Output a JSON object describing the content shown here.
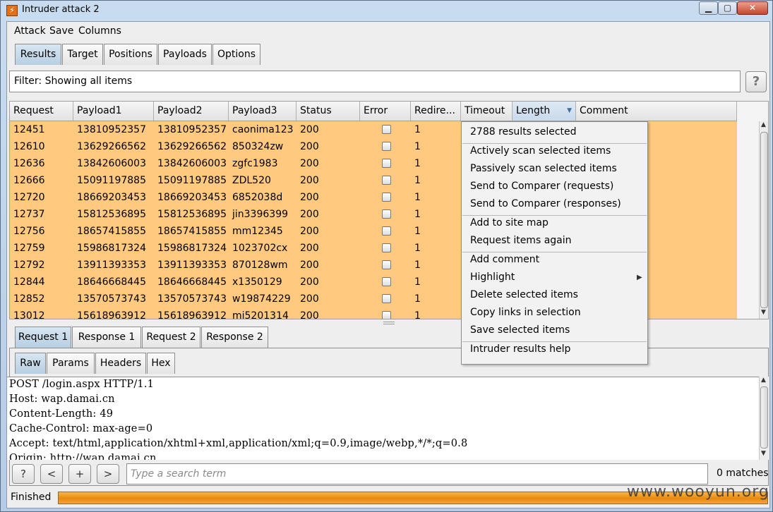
{
  "window": {
    "title": "Intruder attack 2",
    "app_icon": "burp-flame-icon",
    "controls": [
      "minimize-icon",
      "maximize-icon",
      "close-icon"
    ]
  },
  "menubar": [
    "Attack",
    "Save",
    "Columns"
  ],
  "main_tabs": [
    "Results",
    "Target",
    "Positions",
    "Payloads",
    "Options"
  ],
  "filter": {
    "text": "Filter: Showing all items",
    "help": "?"
  },
  "results": {
    "columns": [
      "Request",
      "Payload1",
      "Payload2",
      "Payload3",
      "Status",
      "Error",
      "Redire...",
      "Timeout",
      "Length",
      "Comment"
    ],
    "sorted_column": "Length",
    "rows": [
      [
        "12451",
        "13810952357",
        "13810952357",
        "caonima123",
        "200",
        "",
        "1"
      ],
      [
        "12610",
        "13629266562",
        "13629266562",
        "850324zw",
        "200",
        "",
        "1"
      ],
      [
        "12636",
        "13842606003",
        "13842606003",
        "zgfc1983",
        "200",
        "",
        "1"
      ],
      [
        "12666",
        "15091197885",
        "15091197885",
        "ZDL520",
        "200",
        "",
        "1"
      ],
      [
        "12720",
        "18669203453",
        "18669203453",
        "6852038d",
        "200",
        "",
        "1"
      ],
      [
        "12737",
        "15812536895",
        "15812536895",
        "jin3396399",
        "200",
        "",
        "1"
      ],
      [
        "12756",
        "18657415855",
        "18657415855",
        "mm12345",
        "200",
        "",
        "1"
      ],
      [
        "12759",
        "15986817324",
        "15986817324",
        "1023702cx",
        "200",
        "",
        "1"
      ],
      [
        "12792",
        "13911393353",
        "13911393353",
        "870128wm",
        "200",
        "",
        "1"
      ],
      [
        "12844",
        "18646668445",
        "18646668445",
        "x1350129",
        "200",
        "",
        "1"
      ],
      [
        "12852",
        "13570573743",
        "13570573743",
        "w19874229",
        "200",
        "",
        "1"
      ],
      [
        "13012",
        "15618963912",
        "15618963912",
        "mi5201314",
        "200",
        "",
        "1"
      ]
    ],
    "row_color": "#ffc97f"
  },
  "context_menu": {
    "header": "2788 results selected",
    "group1": [
      "Actively scan selected items",
      "Passively scan selected items",
      "Send to Comparer (requests)",
      "Send to Comparer (responses)"
    ],
    "group2": [
      "Add to site map",
      "Request items again"
    ],
    "group3": [
      "Add comment",
      "Highlight",
      "Delete selected items",
      "Copy links in selection",
      "Save selected items"
    ],
    "group4": [
      "Intruder results help"
    ]
  },
  "detail_tabs": [
    "Request 1",
    "Response 1",
    "Request 2",
    "Response 2"
  ],
  "view_tabs": [
    "Raw",
    "Params",
    "Headers",
    "Hex"
  ],
  "raw_request": [
    "POST /login.aspx HTTP/1.1",
    "Host: wap.damai.cn",
    "Content-Length: 49",
    "Cache-Control: max-age=0",
    "Accept: text/html,application/xhtml+xml,application/xml;q=0.9,image/webp,*/*;q=0.8",
    "Origin: http://wap.damai.cn"
  ],
  "search": {
    "buttons": [
      "?",
      "<",
      "+",
      ">"
    ],
    "placeholder": "Type a search term",
    "matches": "0 matches"
  },
  "status": {
    "text": "Finished",
    "progress": 1.0,
    "color": "#f0a030"
  },
  "watermark": "www.wooyun.org"
}
